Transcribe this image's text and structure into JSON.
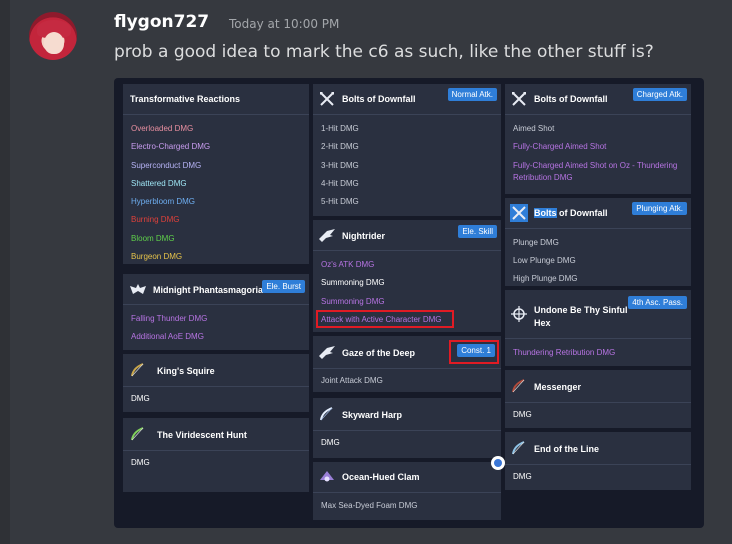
{
  "post": {
    "username": "flygon727",
    "timestamp": "Today at 10:00 PM",
    "message": "prob a good idea to mark the c6 as such, like the other stuff is?"
  },
  "colors": {
    "overloaded": "#e88fa0",
    "electro": "#c99df0",
    "superconduct": "#b6b3f5",
    "shattered": "#9fe6f5",
    "hyperbloom": "#6eaef0",
    "burning": "#e0413a",
    "bloom": "#5fd04a",
    "burgeon": "#e6c34a",
    "purple": "#b774e3",
    "default": "#c8ccd6",
    "white": "#ffffff",
    "badge": "#2f7ed8",
    "highlight_border": "#e01b24"
  },
  "cards": {
    "transformative": {
      "title": "Transformative Reactions",
      "rows": [
        "Overloaded DMG",
        "Electro-Charged DMG",
        "Superconduct DMG",
        "Shattered DMG",
        "Hyperbloom DMG",
        "Burning DMG",
        "Bloom DMG",
        "Burgeon DMG"
      ]
    },
    "phantasmagoria": {
      "title": "Midnight Phantasmagoria",
      "badge": "Ele. Burst",
      "icon": "bat-icon",
      "rows": [
        "Falling Thunder DMG",
        "Additional AoE DMG"
      ]
    },
    "kings_squire": {
      "title": "King's Squire",
      "icon": "bow-icon",
      "rows": [
        "DMG"
      ]
    },
    "viridescent": {
      "title": "The Viridescent Hunt",
      "icon": "bow-icon",
      "rows": [
        "DMG"
      ]
    },
    "bolts_normal": {
      "title": "Bolts of Downfall",
      "badge": "Normal Atk.",
      "icon": "crossed-arrows-icon",
      "rows": [
        "1-Hit DMG",
        "2-Hit DMG",
        "3-Hit DMG",
        "4-Hit DMG",
        "5-Hit DMG"
      ]
    },
    "nightrider": {
      "title": "Nightrider",
      "badge": "Ele. Skill",
      "icon": "raven-icon",
      "rows": [
        "Oz's ATK DMG",
        "Summoning DMG",
        "Summoning DMG",
        "Attack with Active Character DMG"
      ]
    },
    "gaze": {
      "title": "Gaze of the Deep",
      "badge": "Const. 1",
      "icon": "raven-icon",
      "rows": [
        "Joint Attack DMG"
      ]
    },
    "skyward": {
      "title": "Skyward Harp",
      "icon": "bow-icon",
      "rows": [
        "DMG"
      ]
    },
    "clam": {
      "title": "Ocean-Hued Clam",
      "icon": "clam-icon",
      "rows": [
        "Max Sea-Dyed Foam DMG"
      ]
    },
    "bolts_charged": {
      "title": "Bolts of Downfall",
      "badge": "Charged Atk.",
      "icon": "crossed-arrows-icon",
      "rows": [
        "Aimed Shot",
        "Fully-Charged Aimed Shot",
        "Fully-Charged Aimed Shot on Oz - Thundering",
        "Retribution DMG"
      ]
    },
    "bolts_plunging": {
      "title_highlight": "Bolts",
      "title_rest": " of Downfall",
      "badge": "Plunging Atk.",
      "icon": "crossed-arrows-icon",
      "rows": [
        "Plunge DMG",
        "Low Plunge DMG",
        "High Plunge DMG"
      ]
    },
    "undone": {
      "title_line1": "Undone Be Thy Sinful",
      "title_line2": "Hex",
      "badge": "4th Asc. Pass.",
      "icon": "target-icon",
      "rows": [
        "Thundering Retribution DMG"
      ]
    },
    "messenger": {
      "title": "Messenger",
      "icon": "bow-icon",
      "rows": [
        "DMG"
      ]
    },
    "end_of_line": {
      "title": "End of the Line",
      "icon": "bow-icon",
      "rows": [
        "DMG"
      ]
    }
  }
}
